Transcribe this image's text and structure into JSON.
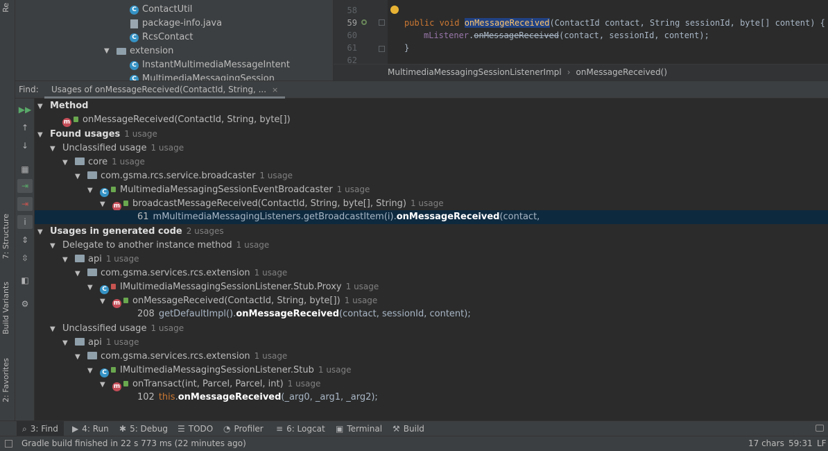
{
  "left_stripe": {
    "top_tab": "Re",
    "structure_tab": "7: Structure",
    "build_variants_tab": "Build Variants",
    "favorites_tab": "2: Favorites"
  },
  "project_tree": {
    "items": [
      {
        "label": "ContactUtil",
        "kind": "class"
      },
      {
        "label": "package-info.java",
        "kind": "file"
      },
      {
        "label": "RcsContact",
        "kind": "class"
      },
      {
        "label": "extension",
        "kind": "folder"
      },
      {
        "label": "InstantMultimediaMessageIntent",
        "kind": "class"
      },
      {
        "label": "MultimediaMessagingSession",
        "kind": "class"
      }
    ]
  },
  "editor": {
    "lines": [
      {
        "num": "58"
      },
      {
        "num": "59",
        "kw1": "public void ",
        "name": "onMessageReceived",
        "rest": "(ContactId contact, String sessionId, byte[] content) {"
      },
      {
        "num": "60",
        "field": "mListener",
        "dot": ".",
        "call": "onMessageReceived",
        "rest": "(contact, sessionId, content);"
      },
      {
        "num": "61",
        "code": "}"
      },
      {
        "num": "62"
      }
    ],
    "breadcrumb": [
      "MultimediaMessagingSessionListenerImpl",
      "onMessageReceived()"
    ]
  },
  "find": {
    "label": "Find:",
    "tab_title": "Usages of onMessageReceived(ContactId, String, ...",
    "tab_close": "×"
  },
  "results": {
    "method_header": "Method",
    "method_sig": "onMessageReceived(ContactId, String, byte[])",
    "found_usages": "Found usages",
    "found_usages_count": "1 usage",
    "unclassified_1": "Unclassified usage",
    "unclassified_1_count": "1 usage",
    "core": "core",
    "core_count": "1 usage",
    "pkg_broadcaster": "com.gsma.rcs.service.broadcaster",
    "pkg_broadcaster_count": "1 usage",
    "class_broadcaster": "MultimediaMessagingSessionEventBroadcaster",
    "class_broadcaster_count": "1 usage",
    "method_broadcast": "broadcastMessageReceived(ContactId, String, byte[], String)",
    "method_broadcast_count": "1 usage",
    "usage1_line": "61",
    "usage1_pre": "mMultimediaMessagingListeners.getBroadcastItem(i).",
    "usage1_match": "onMessageReceived",
    "usage1_post": "(contact,",
    "generated": "Usages in generated code",
    "generated_count": "2 usages",
    "delegate": "Delegate to another instance method",
    "delegate_count": "1 usage",
    "api_1": "api",
    "api_1_count": "1 usage",
    "pkg_ext_1": "com.gsma.services.rcs.extension",
    "pkg_ext_1_count": "1 usage",
    "class_proxy": "IMultimediaMessagingSessionListener.Stub.Proxy",
    "class_proxy_count": "1 usage",
    "method_proxy": "onMessageReceived(ContactId, String, byte[])",
    "method_proxy_count": "1 usage",
    "usage2_line": "208",
    "usage2_pre": "getDefaultImpl().",
    "usage2_match": "onMessageReceived",
    "usage2_post": "(contact, sessionId, content);",
    "unclassified_2": "Unclassified usage",
    "unclassified_2_count": "1 usage",
    "api_2": "api",
    "api_2_count": "1 usage",
    "pkg_ext_2": "com.gsma.services.rcs.extension",
    "pkg_ext_2_count": "1 usage",
    "class_stub": "IMultimediaMessagingSessionListener.Stub",
    "class_stub_count": "1 usage",
    "method_transact": "onTransact(int, Parcel, Parcel, int)",
    "method_transact_count": "1 usage",
    "usage3_line": "102",
    "usage3_this": "this",
    "usage3_dot": ".",
    "usage3_match": "onMessageReceived",
    "usage3_post": "(_arg0, _arg1, _arg2);"
  },
  "tool_tabs": [
    {
      "label": "3: Find",
      "icon": "search-icon"
    },
    {
      "label": "4: Run",
      "icon": "run-icon"
    },
    {
      "label": "5: Debug",
      "icon": "bug-icon"
    },
    {
      "label": "TODO",
      "icon": "list-icon"
    },
    {
      "label": "Profiler",
      "icon": "gauge-icon"
    },
    {
      "label": "6: Logcat",
      "icon": "logcat-icon"
    },
    {
      "label": "Terminal",
      "icon": "terminal-icon"
    },
    {
      "label": "Build",
      "icon": "hammer-icon"
    }
  ],
  "status": {
    "message": "Gradle build finished in 22 s 773 ms (22 minutes ago)",
    "chars": "17 chars",
    "position": "59:31",
    "line_ending": "LF"
  }
}
